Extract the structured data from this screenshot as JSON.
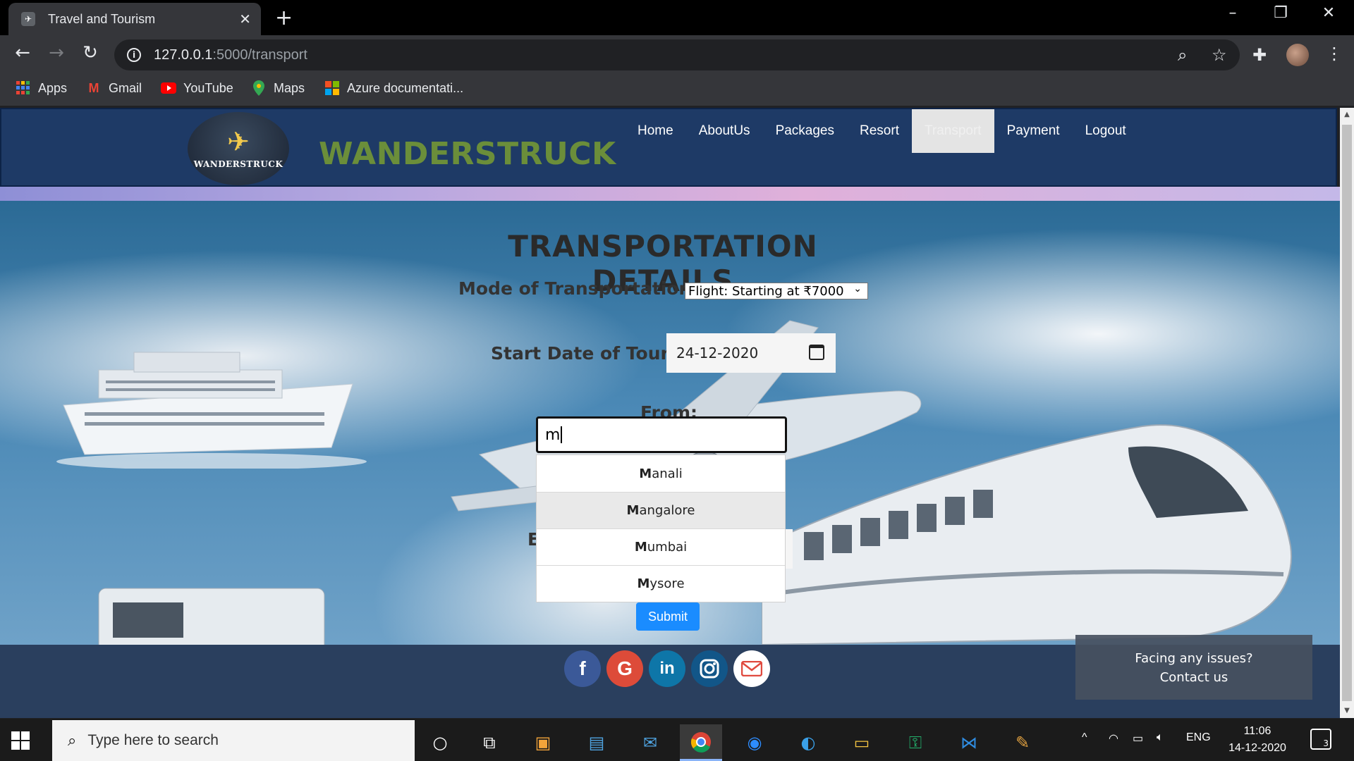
{
  "browser": {
    "tab_title": "Travel and Tourism",
    "url_host": "127.0.0.1",
    "url_path": ":5000/transport",
    "bookmarks": [
      "Apps",
      "Gmail",
      "YouTube",
      "Maps",
      "Azure documentati..."
    ]
  },
  "site": {
    "logo_text": "WANDERSTRUCK",
    "brand": "WANDERSTRUCK",
    "nav": [
      "Home",
      "AboutUs",
      "Packages",
      "Resort",
      "Transport",
      "Payment",
      "Logout"
    ],
    "active_nav": "Transport"
  },
  "form": {
    "title": "TRANSPORTATION DETAILS",
    "mode_label": "Mode of Transportation:",
    "mode_value": "Flight: Starting at ₹7000",
    "date_label": "Start Date of Tour:",
    "date_value": "24-12-2020",
    "from_label": "From:",
    "from_value": "m",
    "suggestions": [
      "Manali",
      "Mangalore",
      "Mumbai",
      "Mysore"
    ],
    "highlighted_suggestion": "Mangalore",
    "hidden_label_fragment": "E",
    "submit_label": "Submit"
  },
  "contact_box": {
    "line1": "Facing any issues?",
    "line2": "Contact us"
  },
  "footer": {
    "socials": [
      "facebook",
      "google",
      "linkedin",
      "instagram",
      "email"
    ]
  },
  "taskbar": {
    "search_placeholder": "Type here to search",
    "language": "ENG",
    "time": "11:06",
    "date": "14-12-2020",
    "notification_count": "3"
  }
}
